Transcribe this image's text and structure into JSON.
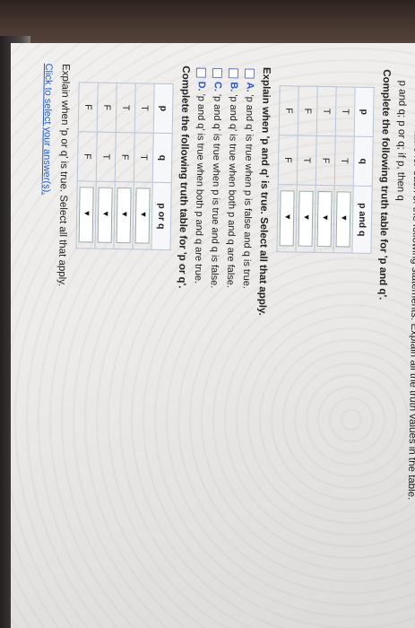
{
  "question": {
    "title": "Make a truth table for each of the following statements. Explain all the truth values in the table.",
    "subtitle": "p and q; p or q; if p, then q"
  },
  "table_and": {
    "instruction": "Complete the following truth table for 'p and q'.",
    "headers": [
      "p",
      "q",
      "p and q"
    ],
    "rows": [
      [
        "T",
        "T"
      ],
      [
        "T",
        "F"
      ],
      [
        "F",
        "T"
      ],
      [
        "F",
        "F"
      ]
    ],
    "dropdown_symbol": "▼"
  },
  "explain_and": {
    "prompt": "Explain when 'p and q' is true. Select all that apply.",
    "options": [
      {
        "letter": "A.",
        "text": "'p and q' is true when p is false and q is true."
      },
      {
        "letter": "B.",
        "text": "'p and q' is true when both p and q are false."
      },
      {
        "letter": "C.",
        "text": "'p and q' is true when p is true and q is false."
      },
      {
        "letter": "D.",
        "text": "'p and q' is true when both p and q are true."
      }
    ]
  },
  "table_or": {
    "instruction": "Complete the following truth table for 'p or q'.",
    "headers": [
      "p",
      "q",
      "p or q"
    ],
    "rows": [
      [
        "T",
        "T"
      ],
      [
        "T",
        "F"
      ],
      [
        "F",
        "T"
      ],
      [
        "F",
        "F"
      ]
    ],
    "dropdown_symbol": "▼"
  },
  "explain_or": {
    "prompt": "Explain when 'p or q' is true. Select all that apply.",
    "link": "Click to select your answer(s)."
  }
}
